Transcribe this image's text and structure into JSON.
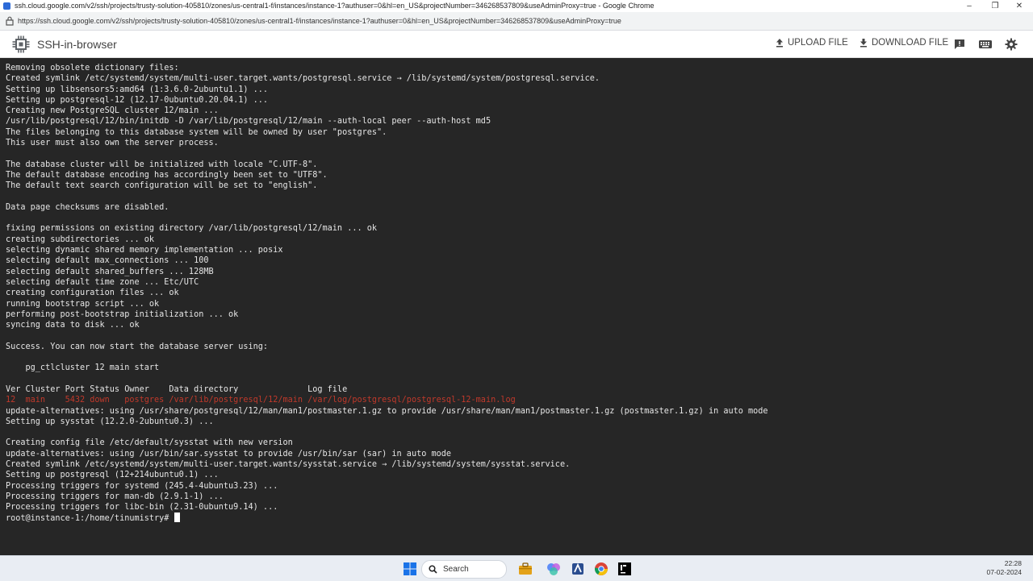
{
  "window": {
    "title": "ssh.cloud.google.com/v2/ssh/projects/trusty-solution-405810/zones/us-central1-f/instances/instance-1?authuser=0&hl=en_US&projectNumber=346268537809&useAdminProxy=true - Google Chrome"
  },
  "address_bar": {
    "url": "https://ssh.cloud.google.com/v2/ssh/projects/trusty-solution-405810/zones/us-central1-f/instances/instance-1?authuser=0&hl=en_US&projectNumber=346268537809&useAdminProxy=true"
  },
  "ssh_header": {
    "brand": "SSH-in-browser",
    "upload_label": "UPLOAD FILE",
    "download_label": "DOWNLOAD FILE",
    "icons": [
      "feedback-icon",
      "keyboard-icon",
      "gear-icon"
    ]
  },
  "terminal": {
    "lines": [
      "Removing obsolete dictionary files:",
      "Created symlink /etc/systemd/system/multi-user.target.wants/postgresql.service → /lib/systemd/system/postgresql.service.",
      "Setting up libsensors5:amd64 (1:3.6.0-2ubuntu1.1) ...",
      "Setting up postgresql-12 (12.17-0ubuntu0.20.04.1) ...",
      "Creating new PostgreSQL cluster 12/main ...",
      "/usr/lib/postgresql/12/bin/initdb -D /var/lib/postgresql/12/main --auth-local peer --auth-host md5",
      "The files belonging to this database system will be owned by user \"postgres\".",
      "This user must also own the server process.",
      "",
      "The database cluster will be initialized with locale \"C.UTF-8\".",
      "The default database encoding has accordingly been set to \"UTF8\".",
      "The default text search configuration will be set to \"english\".",
      "",
      "Data page checksums are disabled.",
      "",
      "fixing permissions on existing directory /var/lib/postgresql/12/main ... ok",
      "creating subdirectories ... ok",
      "selecting dynamic shared memory implementation ... posix",
      "selecting default max_connections ... 100",
      "selecting default shared_buffers ... 128MB",
      "selecting default time zone ... Etc/UTC",
      "creating configuration files ... ok",
      "running bootstrap script ... ok",
      "performing post-bootstrap initialization ... ok",
      "syncing data to disk ... ok",
      "",
      "Success. You can now start the database server using:",
      "",
      "    pg_ctlcluster 12 main start",
      "",
      "Ver Cluster Port Status Owner    Data directory              Log file",
      "12  main    5432 down   postgres /var/lib/postgresql/12/main /var/log/postgresql/postgresql-12-main.log",
      "update-alternatives: using /usr/share/postgresql/12/man/man1/postmaster.1.gz to provide /usr/share/man/man1/postmaster.1.gz (postmaster.1.gz) in auto mode",
      "Setting up sysstat (12.2.0-2ubuntu0.3) ...",
      "",
      "Creating config file /etc/default/sysstat with new version",
      "update-alternatives: using /usr/bin/sar.sysstat to provide /usr/bin/sar (sar) in auto mode",
      "Created symlink /etc/systemd/system/multi-user.target.wants/sysstat.service → /lib/systemd/system/sysstat.service.",
      "Setting up postgresql (12+214ubuntu0.1) ...",
      "Processing triggers for systemd (245.4-4ubuntu3.23) ...",
      "Processing triggers for man-db (2.9.1-1) ...",
      "Processing triggers for libc-bin (2.31-0ubuntu9.14) ..."
    ],
    "red_line_index": 31,
    "prompt": "root@instance-1:/home/tinumistry# "
  },
  "taskbar": {
    "search_placeholder": "Search",
    "icons": [
      "windows-start-icon",
      "search-icon",
      "file-explorer-icon",
      "copilot-icon",
      "app-icon",
      "chrome-icon",
      "intellij-icon"
    ],
    "time": "22:28",
    "date": "07-02-2024"
  }
}
